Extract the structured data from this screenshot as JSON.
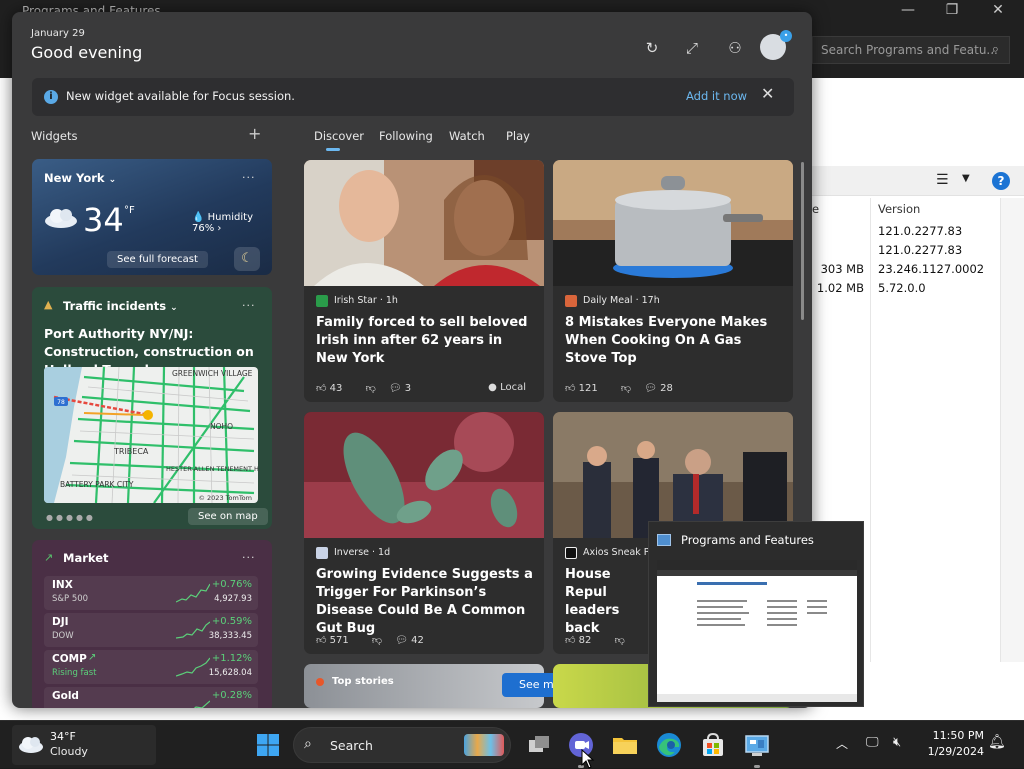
{
  "background_window": {
    "title": "Programs and Features",
    "search_placeholder": "Search Programs and Featu...",
    "size_header": "e",
    "version_header": "Version",
    "rows": [
      {
        "size": "",
        "version": "121.0.2277.83"
      },
      {
        "size": "",
        "version": "121.0.2277.83"
      },
      {
        "size": "303 MB",
        "version": "23.246.1127.0002"
      },
      {
        "size": "1.02 MB",
        "version": "5.72.0.0"
      }
    ]
  },
  "widgets": {
    "date": "January 29",
    "greeting": "Good evening",
    "banner": {
      "message": "New widget available for Focus session.",
      "action": "Add it now"
    },
    "widgets_label": "Widgets",
    "weather": {
      "location": "New York",
      "temperature": "34",
      "unit": "°F",
      "humidity": "Humidity 76%",
      "forecast_link": "See full forecast"
    },
    "traffic": {
      "title": "Traffic incidents",
      "headline": "Port Authority NY/NJ: Construction, construction on Holland Tunnel...",
      "map_labels": [
        "GREENWICH VILLAGE",
        "NOHO",
        "TRIBECA",
        "HESTER-ALLEN TENEMENT HOUSING",
        "BATTERY PARK CITY",
        "© 2023 TomTom",
        "78"
      ],
      "see_map": "See on map"
    },
    "market": {
      "title": "Market",
      "rows": [
        {
          "symbol": "INX",
          "name": "S&P 500",
          "change": "+0.76%",
          "value": "4,927.93"
        },
        {
          "symbol": "DJI",
          "name": "DOW",
          "change": "+0.59%",
          "value": "38,333.45"
        },
        {
          "symbol": "COMP",
          "name": "Rising fast",
          "change": "+1.12%",
          "value": "15,628.04"
        },
        {
          "symbol": "Gold",
          "name": "",
          "change": "+0.28%",
          "value": ""
        }
      ]
    },
    "feed_tabs": [
      "Discover",
      "Following",
      "Watch",
      "Play"
    ],
    "news": [
      {
        "source": "Irish Star · 1h",
        "headline": "Family forced to sell beloved Irish inn after 62 years in New York",
        "likes": "43",
        "comments": "3",
        "tag": "Local"
      },
      {
        "source": "Daily Meal · 17h",
        "headline": "8 Mistakes Everyone Makes When Cooking On A Gas Stove Top",
        "likes": "121",
        "comments": "28",
        "tag": ""
      },
      {
        "source": "Inverse · 1d",
        "headline": "Growing Evidence Suggests a Trigger For Parkinson’s Disease Could Be A Common Gut Bug",
        "likes": "571",
        "comments": "42",
        "tag": ""
      },
      {
        "source": "Axios Sneak Pe",
        "headline": "House Repul leaders back",
        "likes": "82",
        "comments": "",
        "tag": ""
      }
    ],
    "top_stories": "Top stories",
    "see_more": "See more"
  },
  "task_preview": {
    "title": "Programs and Features"
  },
  "taskbar": {
    "weather_temp": "34°F",
    "weather_cond": "Cloudy",
    "search_label": "Search",
    "time": "11:50 PM",
    "date": "1/29/2024"
  },
  "colors": {
    "accent": "#6cb8f0",
    "market_up": "#5bd07a",
    "panel_bg": "#3a3a3b"
  }
}
